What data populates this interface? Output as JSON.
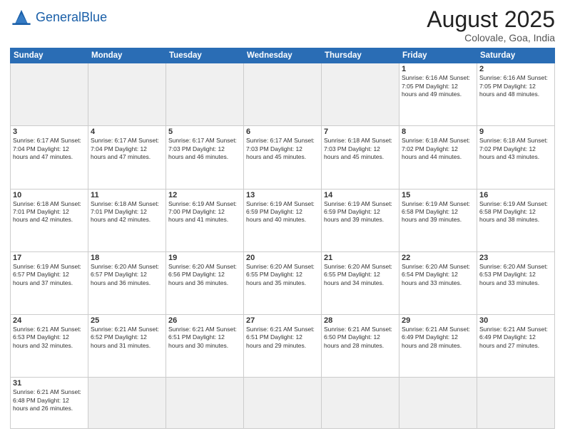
{
  "logo": {
    "text_general": "General",
    "text_blue": "Blue"
  },
  "header": {
    "title": "August 2025",
    "subtitle": "Colovale, Goa, India"
  },
  "weekdays": [
    "Sunday",
    "Monday",
    "Tuesday",
    "Wednesday",
    "Thursday",
    "Friday",
    "Saturday"
  ],
  "weeks": [
    [
      {
        "day": "",
        "info": ""
      },
      {
        "day": "",
        "info": ""
      },
      {
        "day": "",
        "info": ""
      },
      {
        "day": "",
        "info": ""
      },
      {
        "day": "",
        "info": ""
      },
      {
        "day": "1",
        "info": "Sunrise: 6:16 AM\nSunset: 7:05 PM\nDaylight: 12 hours and 49 minutes."
      },
      {
        "day": "2",
        "info": "Sunrise: 6:16 AM\nSunset: 7:05 PM\nDaylight: 12 hours and 48 minutes."
      }
    ],
    [
      {
        "day": "3",
        "info": "Sunrise: 6:17 AM\nSunset: 7:04 PM\nDaylight: 12 hours and 47 minutes."
      },
      {
        "day": "4",
        "info": "Sunrise: 6:17 AM\nSunset: 7:04 PM\nDaylight: 12 hours and 47 minutes."
      },
      {
        "day": "5",
        "info": "Sunrise: 6:17 AM\nSunset: 7:03 PM\nDaylight: 12 hours and 46 minutes."
      },
      {
        "day": "6",
        "info": "Sunrise: 6:17 AM\nSunset: 7:03 PM\nDaylight: 12 hours and 45 minutes."
      },
      {
        "day": "7",
        "info": "Sunrise: 6:18 AM\nSunset: 7:03 PM\nDaylight: 12 hours and 45 minutes."
      },
      {
        "day": "8",
        "info": "Sunrise: 6:18 AM\nSunset: 7:02 PM\nDaylight: 12 hours and 44 minutes."
      },
      {
        "day": "9",
        "info": "Sunrise: 6:18 AM\nSunset: 7:02 PM\nDaylight: 12 hours and 43 minutes."
      }
    ],
    [
      {
        "day": "10",
        "info": "Sunrise: 6:18 AM\nSunset: 7:01 PM\nDaylight: 12 hours and 42 minutes."
      },
      {
        "day": "11",
        "info": "Sunrise: 6:18 AM\nSunset: 7:01 PM\nDaylight: 12 hours and 42 minutes."
      },
      {
        "day": "12",
        "info": "Sunrise: 6:19 AM\nSunset: 7:00 PM\nDaylight: 12 hours and 41 minutes."
      },
      {
        "day": "13",
        "info": "Sunrise: 6:19 AM\nSunset: 6:59 PM\nDaylight: 12 hours and 40 minutes."
      },
      {
        "day": "14",
        "info": "Sunrise: 6:19 AM\nSunset: 6:59 PM\nDaylight: 12 hours and 39 minutes."
      },
      {
        "day": "15",
        "info": "Sunrise: 6:19 AM\nSunset: 6:58 PM\nDaylight: 12 hours and 39 minutes."
      },
      {
        "day": "16",
        "info": "Sunrise: 6:19 AM\nSunset: 6:58 PM\nDaylight: 12 hours and 38 minutes."
      }
    ],
    [
      {
        "day": "17",
        "info": "Sunrise: 6:19 AM\nSunset: 6:57 PM\nDaylight: 12 hours and 37 minutes."
      },
      {
        "day": "18",
        "info": "Sunrise: 6:20 AM\nSunset: 6:57 PM\nDaylight: 12 hours and 36 minutes."
      },
      {
        "day": "19",
        "info": "Sunrise: 6:20 AM\nSunset: 6:56 PM\nDaylight: 12 hours and 36 minutes."
      },
      {
        "day": "20",
        "info": "Sunrise: 6:20 AM\nSunset: 6:55 PM\nDaylight: 12 hours and 35 minutes."
      },
      {
        "day": "21",
        "info": "Sunrise: 6:20 AM\nSunset: 6:55 PM\nDaylight: 12 hours and 34 minutes."
      },
      {
        "day": "22",
        "info": "Sunrise: 6:20 AM\nSunset: 6:54 PM\nDaylight: 12 hours and 33 minutes."
      },
      {
        "day": "23",
        "info": "Sunrise: 6:20 AM\nSunset: 6:53 PM\nDaylight: 12 hours and 33 minutes."
      }
    ],
    [
      {
        "day": "24",
        "info": "Sunrise: 6:21 AM\nSunset: 6:53 PM\nDaylight: 12 hours and 32 minutes."
      },
      {
        "day": "25",
        "info": "Sunrise: 6:21 AM\nSunset: 6:52 PM\nDaylight: 12 hours and 31 minutes."
      },
      {
        "day": "26",
        "info": "Sunrise: 6:21 AM\nSunset: 6:51 PM\nDaylight: 12 hours and 30 minutes."
      },
      {
        "day": "27",
        "info": "Sunrise: 6:21 AM\nSunset: 6:51 PM\nDaylight: 12 hours and 29 minutes."
      },
      {
        "day": "28",
        "info": "Sunrise: 6:21 AM\nSunset: 6:50 PM\nDaylight: 12 hours and 28 minutes."
      },
      {
        "day": "29",
        "info": "Sunrise: 6:21 AM\nSunset: 6:49 PM\nDaylight: 12 hours and 28 minutes."
      },
      {
        "day": "30",
        "info": "Sunrise: 6:21 AM\nSunset: 6:49 PM\nDaylight: 12 hours and 27 minutes."
      }
    ],
    [
      {
        "day": "31",
        "info": "Sunrise: 6:21 AM\nSunset: 6:48 PM\nDaylight: 12 hours and 26 minutes."
      },
      {
        "day": "",
        "info": ""
      },
      {
        "day": "",
        "info": ""
      },
      {
        "day": "",
        "info": ""
      },
      {
        "day": "",
        "info": ""
      },
      {
        "day": "",
        "info": ""
      },
      {
        "day": "",
        "info": ""
      }
    ]
  ]
}
